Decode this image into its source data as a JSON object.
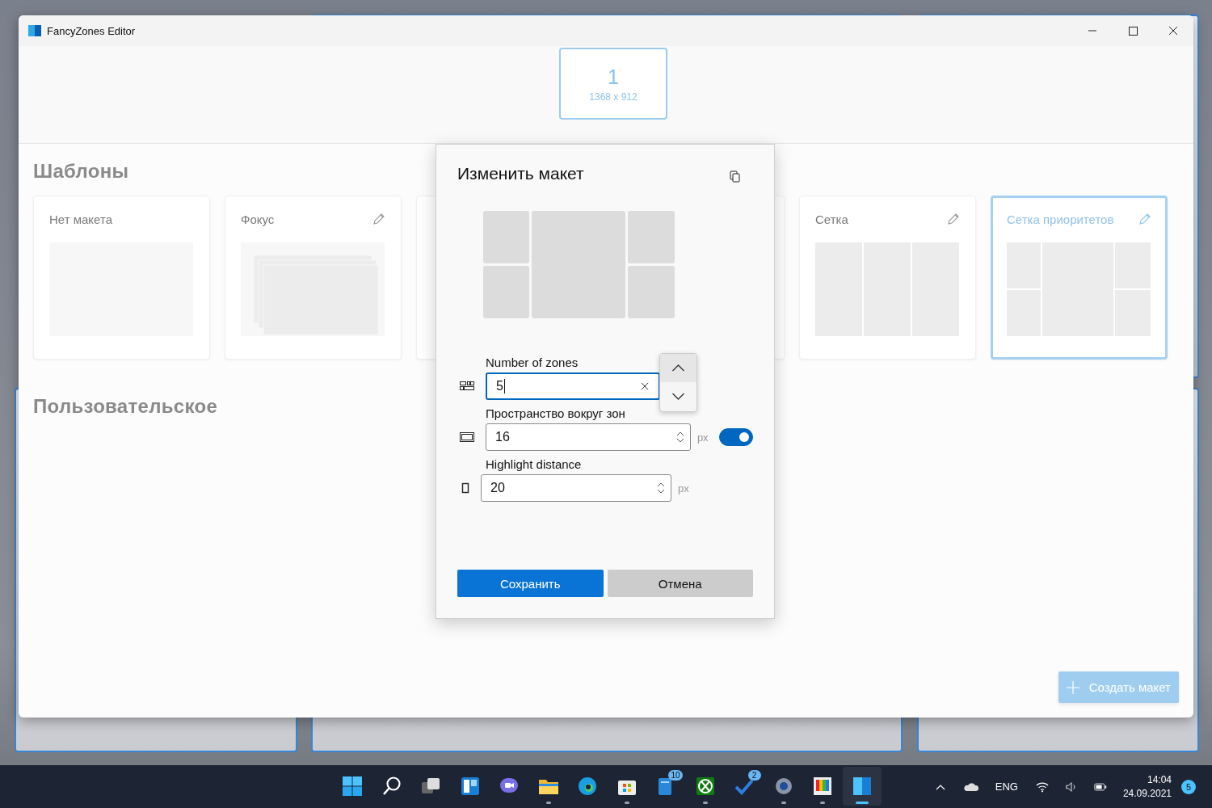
{
  "window": {
    "title": "FancyZones Editor"
  },
  "monitors": [
    {
      "number": "1",
      "resolution": "1368 x 912",
      "selected": true
    }
  ],
  "templates": {
    "heading": "Шаблоны",
    "cards": [
      {
        "title": "Нет макета",
        "kind": "blank",
        "editable": false,
        "selected": false
      },
      {
        "title": "Фокус",
        "kind": "focus",
        "editable": true,
        "selected": false
      },
      {
        "kind": "hidden",
        "selected": false
      },
      {
        "kind": "hidden",
        "selected": false
      },
      {
        "title": "Сетка",
        "kind": "grid",
        "editable": true,
        "selected": false
      },
      {
        "title": "Сетка приоритетов",
        "kind": "priority",
        "editable": true,
        "selected": true
      }
    ]
  },
  "custom": {
    "heading": "Пользовательское"
  },
  "create_button": {
    "label": "Создать макет"
  },
  "dialog": {
    "title": "Изменить макет",
    "fields": [
      {
        "kind": "zones",
        "label": "Number of zones",
        "value": "5",
        "focused": true
      },
      {
        "kind": "spacing",
        "label": "Пространство вокруг зон",
        "value": "16",
        "unit": "px",
        "toggle_on": true
      },
      {
        "kind": "distance",
        "label": "Highlight distance",
        "value": "20",
        "unit": "px"
      }
    ],
    "save": "Сохранить",
    "cancel": "Отмена"
  },
  "taskbar": {
    "apps": [
      {
        "kind": "start",
        "running": false,
        "selected": false
      },
      {
        "kind": "search",
        "running": false,
        "selected": false
      },
      {
        "kind": "taskview",
        "running": false,
        "selected": false
      },
      {
        "kind": "widgets",
        "running": false,
        "selected": false
      },
      {
        "kind": "chat",
        "running": false,
        "selected": false
      },
      {
        "kind": "folder",
        "running": true,
        "selected": false
      },
      {
        "kind": "browser",
        "running": false,
        "selected": false
      },
      {
        "kind": "store",
        "running": true,
        "selected": false
      },
      {
        "kind": "notes",
        "running": false,
        "selected": false,
        "badge": "10"
      },
      {
        "kind": "xbox",
        "running": true,
        "selected": false
      },
      {
        "kind": "todo",
        "running": false,
        "selected": false,
        "badge": "2"
      },
      {
        "kind": "settings",
        "running": true,
        "selected": false
      },
      {
        "kind": "palette",
        "running": true,
        "selected": false
      },
      {
        "kind": "zones",
        "running": true,
        "selected": true
      }
    ],
    "language": "ENG",
    "time": "14:04",
    "date": "24.09.2021",
    "notifications": "5"
  }
}
